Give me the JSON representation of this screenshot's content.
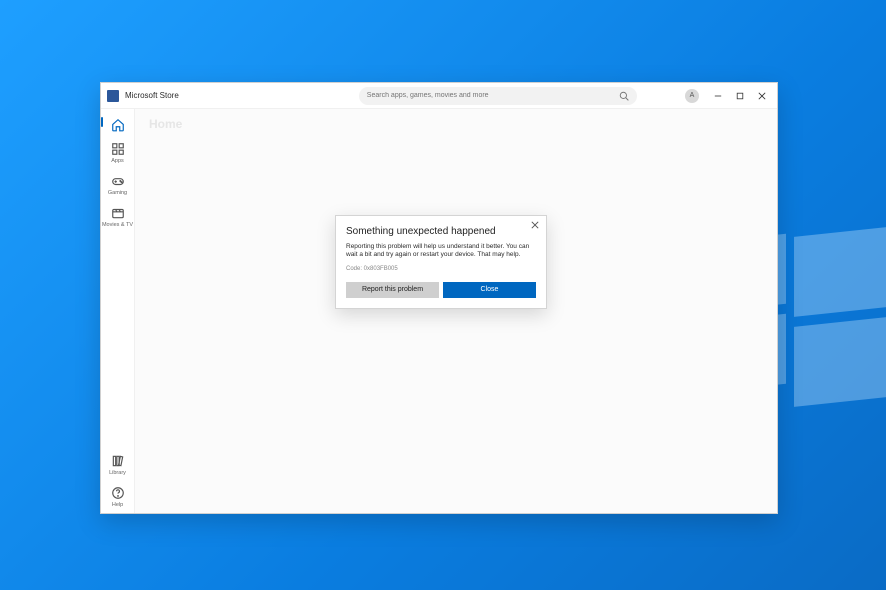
{
  "app": {
    "title": "Microsoft Store"
  },
  "search": {
    "placeholder": "Search apps, games, movies and more"
  },
  "avatar": {
    "initial": "A"
  },
  "sidebar": {
    "items": [
      {
        "label": "Home"
      },
      {
        "label": "Apps"
      },
      {
        "label": "Gaming"
      },
      {
        "label": "Movies & TV"
      }
    ],
    "bottom": [
      {
        "label": "Library"
      },
      {
        "label": "Help"
      }
    ]
  },
  "page": {
    "title": "Home"
  },
  "dialog": {
    "title": "Something unexpected happened",
    "body": "Reporting this problem will help us understand it better. You can wait a bit and try again or restart your device. That may help.",
    "code": "Code: 0x803FB005",
    "report_label": "Report this problem",
    "close_label": "Close"
  }
}
